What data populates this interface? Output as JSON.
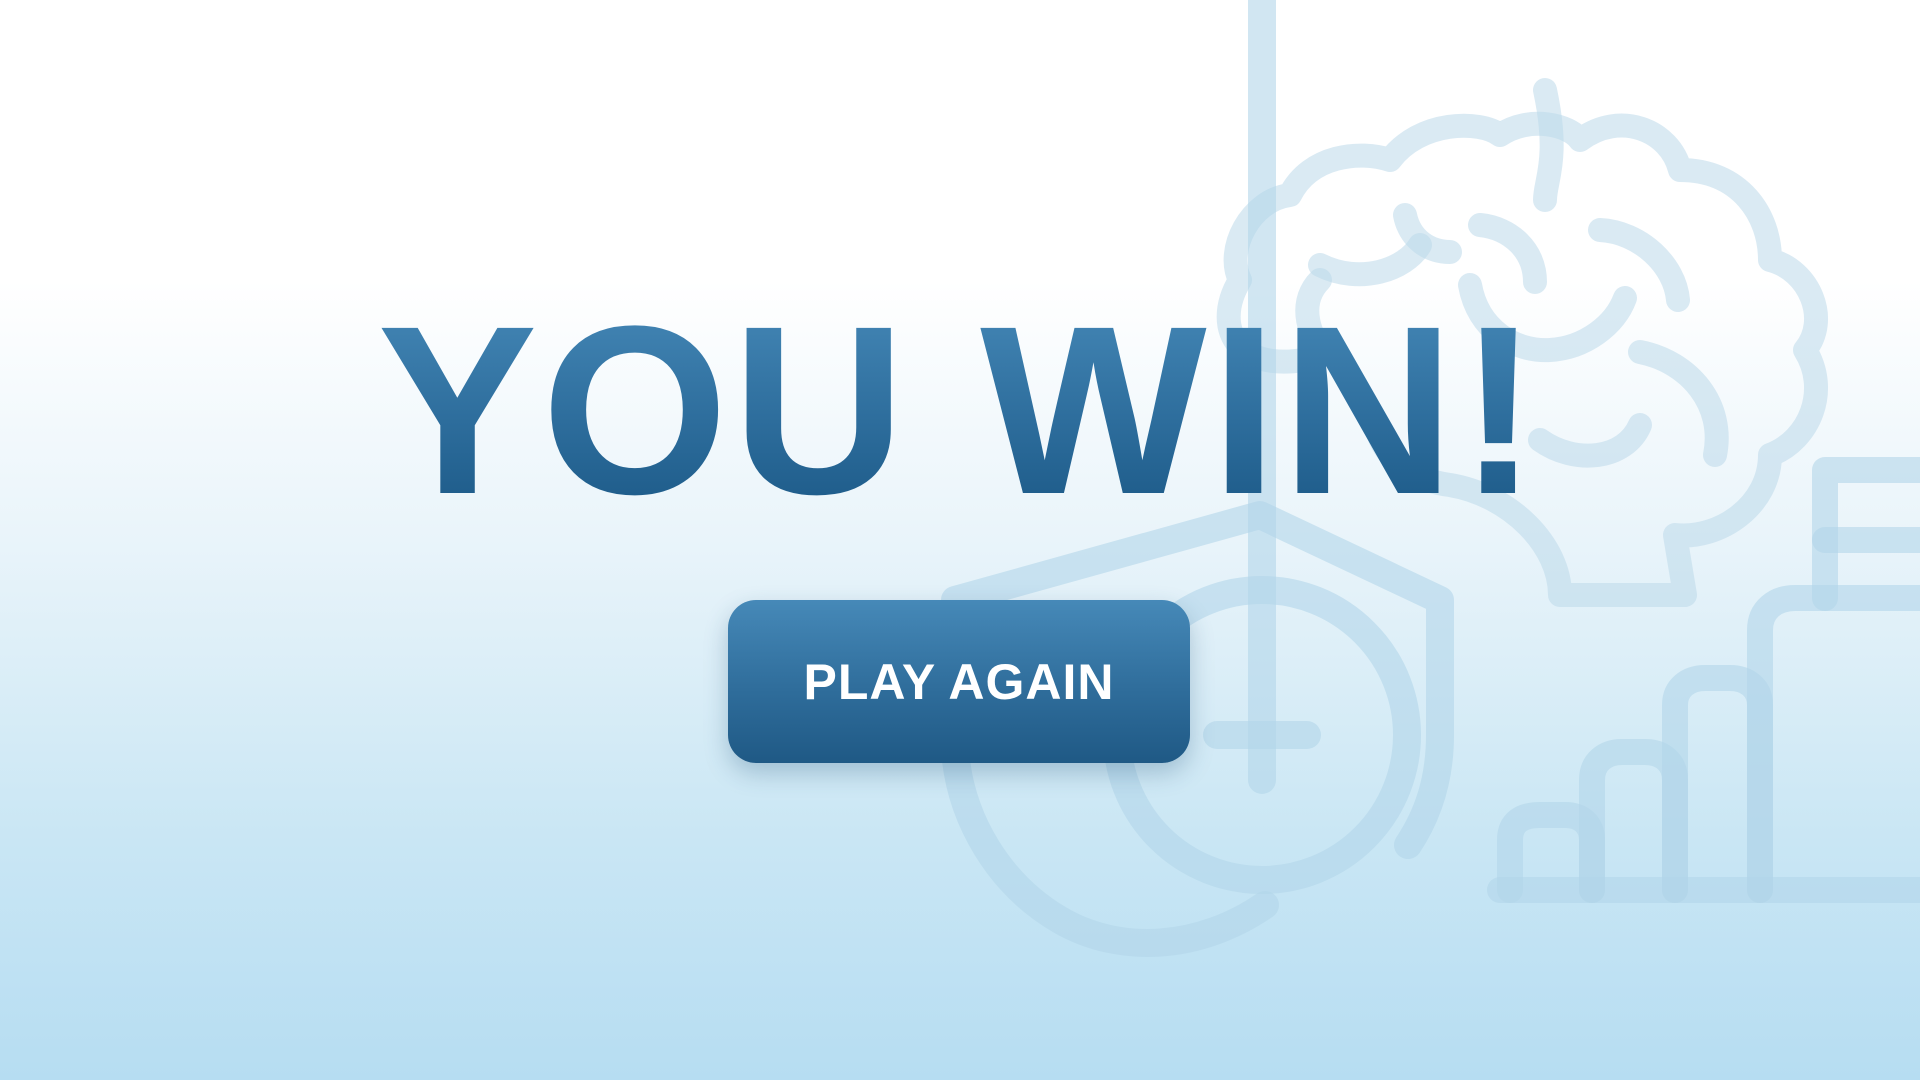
{
  "screen": {
    "title": "YOU WIN!",
    "play_again_label": "PLAY AGAIN"
  },
  "decorations": {
    "icons": [
      "brain-icon",
      "shield-plus-icon",
      "bar-chart-flag-icon"
    ]
  },
  "colors": {
    "title_top": "#4689b8",
    "title_bottom": "#1a5785",
    "button_top": "#4689b8",
    "button_bottom": "#1f5985",
    "button_text": "#ffffff",
    "icon_stroke": "#bcd9ea",
    "background_top": "#ffffff",
    "background_bottom": "#b6ddf2"
  }
}
